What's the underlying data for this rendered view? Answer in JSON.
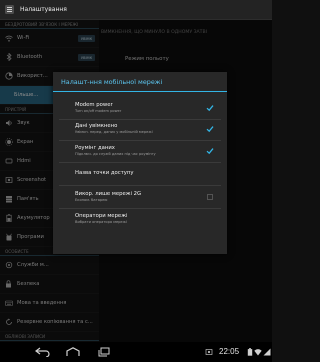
{
  "actionbar": {
    "title": "Налаштування"
  },
  "sidebar": {
    "section_wireless": "БЕЗДРОТОВИЙ ЗВ'ЯЗОК І МЕРЕЖІ",
    "wifi": {
      "label": "Wi-Fi",
      "toggle": "УВІМК"
    },
    "bluetooth": {
      "label": "Bluetooth",
      "toggle": "УВІМК"
    },
    "data_usage": {
      "label": "Використ..."
    },
    "more": {
      "label": "Більше..."
    },
    "section_device": "ПРИСТРІЙ",
    "sound": {
      "label": "Звук"
    },
    "display": {
      "label": "Екран"
    },
    "hdmi": {
      "label": "Hdmi"
    },
    "screenshot": {
      "label": "Screenshot"
    },
    "storage": {
      "label": "Пам'ять"
    },
    "battery": {
      "label": "Акумулятор"
    },
    "apps": {
      "label": "Програми"
    },
    "section_personal": "ОСОБИСТЕ",
    "location": {
      "label": "Служби м..."
    },
    "security": {
      "label": "Безпека"
    },
    "language": {
      "label": "Мова та введення"
    },
    "backup": {
      "label": "Резервне копіювання та с..."
    },
    "section_accounts": "ОБЛІКОВІ ЗАПИСИ"
  },
  "pane": {
    "ghost_header": "ВИМКНЕННЯ, ЩО МИНУЛО В ОДНОМУ ЗАТВІ",
    "flight_mode": "Режим польоту"
  },
  "dialog": {
    "title": "Налашт-ння мобільної мережі",
    "options": [
      {
        "title": "Modem power",
        "subtitle": "Turn on/off modem power",
        "checked": true
      },
      {
        "title": "Дані увімкнено",
        "subtitle": "Увімкн. перед. даних у мобільній мережі",
        "checked": true
      },
      {
        "title": "Роумінг даних",
        "subtitle": "Підключ. до служб даних під час роумінгу",
        "checked": true
      },
      {
        "title": "Назва точки доступу",
        "subtitle": "",
        "checked": null
      },
      {
        "title": "Викор. лише мережі 2G",
        "subtitle": "Економ. батарею",
        "checked": false
      },
      {
        "title": "Оператори мережі",
        "subtitle": "Вибрати оператора мережі",
        "checked": null
      }
    ]
  },
  "navbar": {
    "clock": "22:05"
  },
  "colors": {
    "accent": "#33b5e5",
    "dialog_bg": "#282828"
  },
  "icons": [
    "app-settings-icon",
    "back-icon",
    "home-icon",
    "recent-apps-icon",
    "screenshot-icon",
    "battery-icon",
    "wifi-icon",
    "signal-icon"
  ]
}
